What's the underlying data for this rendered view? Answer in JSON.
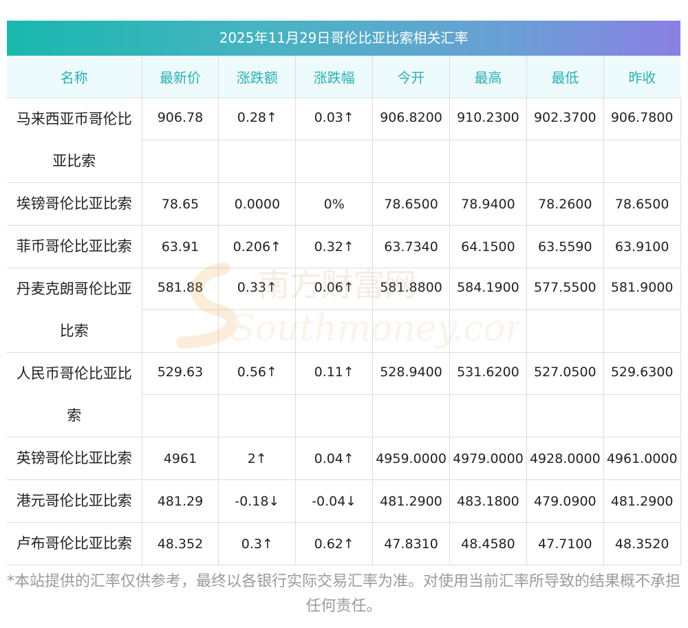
{
  "title": "2025年11月29日哥伦比亚比索相关汇率",
  "headers": [
    "名称",
    "最新价",
    "涨跌额",
    "涨跌幅",
    "今开",
    "最高",
    "最低",
    "昨收"
  ],
  "rows": [
    {
      "name": "马来西亚币哥伦比亚比索",
      "last": "906.78",
      "change": "0.28↑",
      "pct": "0.03↑",
      "open": "906.8200",
      "high": "910.2300",
      "low": "902.3700",
      "prev": "906.7800",
      "trend": "up"
    },
    {
      "name": "埃镑哥伦比亚比索",
      "last": "78.65",
      "change": "0.0000",
      "pct": "0%",
      "open": "78.6500",
      "high": "78.9400",
      "low": "78.2600",
      "prev": "78.6500",
      "trend": "flat"
    },
    {
      "name": "菲币哥伦比亚比索",
      "last": "63.91",
      "change": "0.206↑",
      "pct": "0.32↑",
      "open": "63.7340",
      "high": "64.1500",
      "low": "63.5590",
      "prev": "63.9100",
      "trend": "up"
    },
    {
      "name": "丹麦克朗哥伦比亚比索",
      "last": "581.88",
      "change": "0.33↑",
      "pct": "0.06↑",
      "open": "581.8800",
      "high": "584.1900",
      "low": "577.5500",
      "prev": "581.9000",
      "trend": "up"
    },
    {
      "name": "人民币哥伦比亚比索",
      "last": "529.63",
      "change": "0.56↑",
      "pct": "0.11↑",
      "open": "528.9400",
      "high": "531.6200",
      "low": "527.0500",
      "prev": "529.6300",
      "trend": "up"
    },
    {
      "name": "英镑哥伦比亚比索",
      "last": "4961",
      "change": "2↑",
      "pct": "0.04↑",
      "open": "4959.0000",
      "high": "4979.0000",
      "low": "4928.0000",
      "prev": "4961.0000",
      "trend": "up"
    },
    {
      "name": "港元哥伦比亚比索",
      "last": "481.29",
      "change": "-0.18↓",
      "pct": "-0.04↓",
      "open": "481.2900",
      "high": "483.1800",
      "low": "479.0900",
      "prev": "481.2900",
      "trend": "down"
    },
    {
      "name": "卢布哥伦比亚比索",
      "last": "48.352",
      "change": "0.3↑",
      "pct": "0.62↑",
      "open": "47.8310",
      "high": "48.4580",
      "low": "47.7100",
      "prev": "48.3520",
      "trend": "up"
    }
  ],
  "watermark": {
    "cn": "南方财富网",
    "en": "Southmoney.com"
  },
  "note": "*本站提供的汇率仅供参考，最终以各银行实际交易汇率为准。对使用当前汇率所导致的结果概不承担任何责任。",
  "colors": {
    "up": "#e8212a",
    "down": "#1e8c1e",
    "header_text": "#2ab0b4",
    "header_bg": "#eefbfc"
  }
}
